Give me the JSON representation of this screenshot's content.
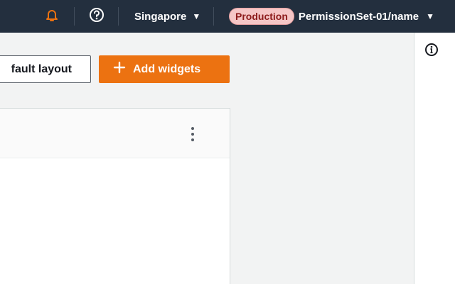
{
  "topbar": {
    "region": "Singapore",
    "environment_badge": "Production",
    "account": "PermissionSet-01/name",
    "icons": {
      "notifications": "bell-icon",
      "help": "help-circle-icon",
      "caret": "caret-down-icon"
    },
    "colors": {
      "background": "#232f3e",
      "bell": "#ec7211",
      "badge_bg": "#f5c6c6",
      "badge_text": "#8c1b1b"
    }
  },
  "toolbar": {
    "reset_label": "fault layout",
    "add_label": "Add widgets",
    "colors": {
      "primary": "#ec7211"
    }
  },
  "widget": {
    "icons": {
      "menu": "vertical-dots-icon"
    }
  },
  "right_rail": {
    "icons": {
      "info": "info-icon"
    }
  }
}
